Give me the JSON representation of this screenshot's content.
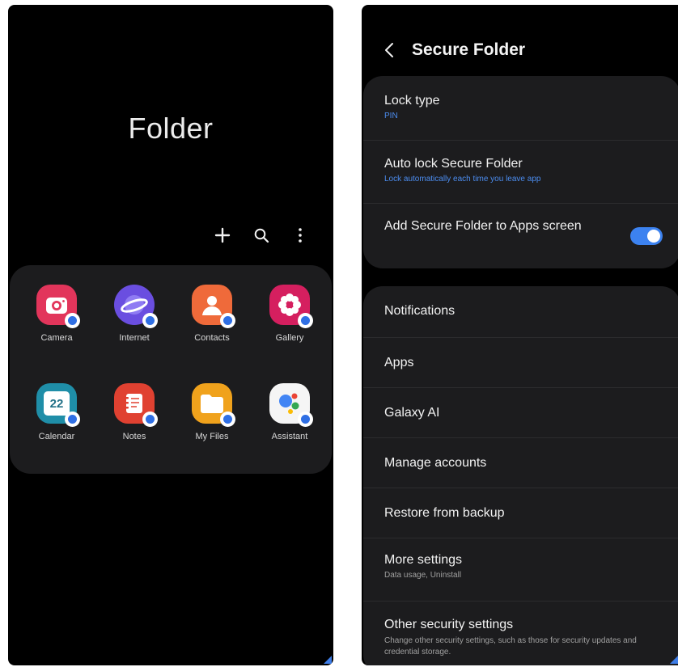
{
  "left_screen": {
    "title": "Folder",
    "toolbar": {
      "add_icon": "plus-icon",
      "search_icon": "search-icon",
      "more_icon": "more-vertical-icon"
    },
    "apps": [
      {
        "label": "Camera",
        "icon": "camera-icon",
        "color": "#e2355b"
      },
      {
        "label": "Internet",
        "icon": "internet-icon",
        "color": "#6a4ee0"
      },
      {
        "label": "Contacts",
        "icon": "contacts-icon",
        "color": "#ef6a3a"
      },
      {
        "label": "Gallery",
        "icon": "gallery-icon",
        "color": "#d51f5f"
      },
      {
        "label": "Calendar",
        "icon": "calendar-icon",
        "color": "#1f8ea8",
        "date": "22"
      },
      {
        "label": "Notes",
        "icon": "notes-icon",
        "color": "#e04131"
      },
      {
        "label": "My Files",
        "icon": "folder-icon",
        "color": "#f0a21c"
      },
      {
        "label": "Assistant",
        "icon": "assistant-icon",
        "color": "#f5f5f5"
      }
    ]
  },
  "right_screen": {
    "header": {
      "back_icon": "chevron-left-icon",
      "title": "Secure Folder"
    },
    "group1": [
      {
        "title": "Lock type",
        "subtitle": "PIN"
      },
      {
        "title": "Auto lock Secure Folder",
        "subtitle": "Lock automatically each time you leave app"
      },
      {
        "title": "Add Secure Folder to Apps screen",
        "toggle": true
      }
    ],
    "group2": [
      {
        "title": "Notifications"
      },
      {
        "title": "Apps"
      },
      {
        "title": "Galaxy AI"
      },
      {
        "title": "Manage accounts"
      },
      {
        "title": "Restore from backup"
      },
      {
        "title": "More settings",
        "subtitle": "Data usage, Uninstall"
      },
      {
        "title": "Other security settings",
        "subtitle": "Change other security settings, such as those for security updates and credential storage."
      }
    ]
  },
  "colors": {
    "background": "#000000",
    "card": "#1c1c1e",
    "accent": "#3c82f0",
    "subtitle_blue": "#4c8df0"
  }
}
